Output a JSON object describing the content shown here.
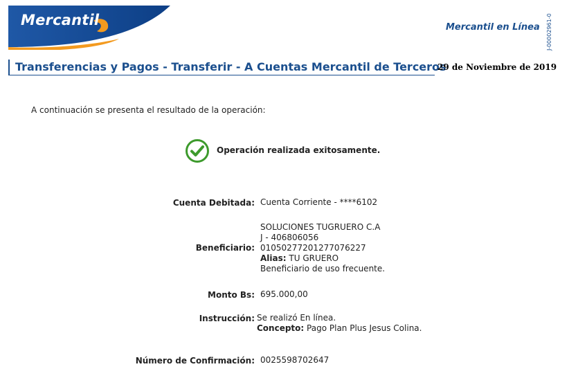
{
  "header": {
    "brand": "Mercantil",
    "site_name": "Mercantil en Línea",
    "page_code": "J-00002961-0"
  },
  "page": {
    "title": "Transferencias y Pagos - Transferir - A Cuentas Mercantil de Terceros",
    "date": "29 de Noviembre de 2019",
    "intro": "A continuación se presenta el resultado de la operación:",
    "success_message": "Operación realizada exitosamente."
  },
  "details": {
    "cuenta_debitada": {
      "label": "Cuenta Debitada:",
      "value": "Cuenta Corriente - ****6102"
    },
    "beneficiario": {
      "label": "Beneficiario:",
      "name": "SOLUCIONES TUGRUERO C.A",
      "rif": "J - 406806056",
      "account": "01050277201277076227",
      "alias_label": "Alias:",
      "alias": "TU GRUERO",
      "note": "Beneficiario de uso frecuente."
    },
    "monto": {
      "label": "Monto Bs:",
      "value": "695.000,00"
    },
    "instruccion": {
      "label": "Instrucción:",
      "value": "Se realizó En línea.",
      "concepto_label": "Concepto:",
      "concepto": "Pago Plan Plus Jesus Colina."
    },
    "confirmacion": {
      "label": "Número de Confirmación:",
      "value": "0025598702647"
    }
  },
  "colors": {
    "brand_blue": "#1b4f8e",
    "logo_orange": "#f39a1f",
    "success_green": "#3d9a2c"
  },
  "icons": {
    "status": "check-circle-icon",
    "logo": "mercantil-logo-icon"
  }
}
